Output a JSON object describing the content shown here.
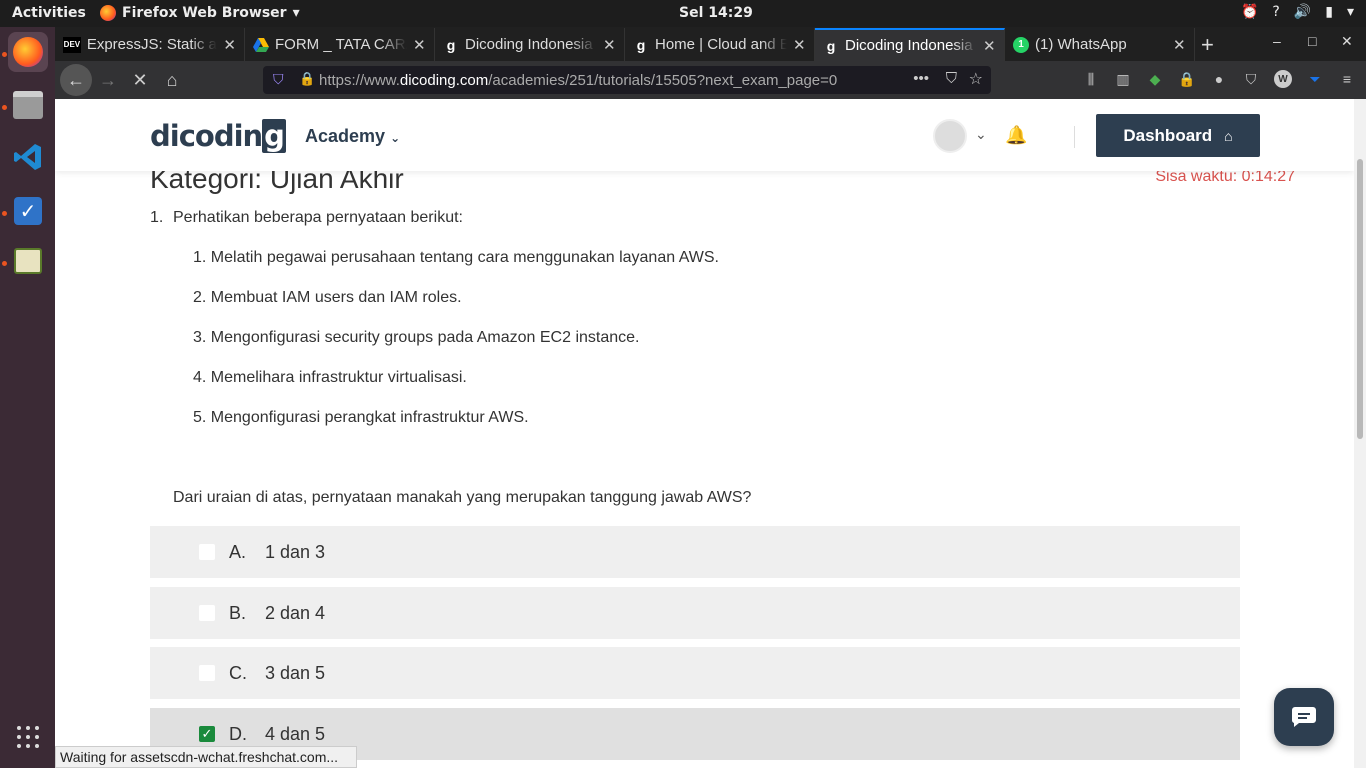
{
  "topbar": {
    "activities": "Activities",
    "app_name": "Firefox Web Browser",
    "clock": "Sel 14:29",
    "tray_help": "?"
  },
  "tabs": [
    {
      "favicon": "DEV",
      "title": "ExpressJS: Static and",
      "active": false
    },
    {
      "favicon": "drive-icon",
      "title": "FORM _ TATA CARA",
      "active": false
    },
    {
      "favicon": "dicoding-icon",
      "title": "Dicoding Indonesia",
      "active": false
    },
    {
      "favicon": "dicoding-icon",
      "title": "Home | Cloud and E",
      "active": false
    },
    {
      "favicon": "dicoding-icon",
      "title": "Dicoding Indonesia",
      "active": true
    },
    {
      "favicon": "whatsapp-icon",
      "title": "(1) WhatsApp",
      "active": false
    }
  ],
  "navbar": {
    "url_prefix": "https://www.",
    "url_domain": "dicoding.com",
    "url_path": "/academies/251/tutorials/15505?next_exam_page=0"
  },
  "header": {
    "logo": "dicodin",
    "logo_g": "g",
    "menu_academy": "Academy",
    "dashboard_label": "Dashboard"
  },
  "exam": {
    "heading": "Kategori: Ujian Akhir",
    "timer": "Sisa waktu: 0:14:27",
    "question_number": "1.",
    "intro": "Perhatikan beberapa pernyataan berikut:",
    "statements": [
      "1. Melatih pegawai perusahaan tentang cara menggunakan layanan AWS.",
      "2. Membuat IAM users dan IAM roles.",
      "3. Mengonfigurasi security groups pada Amazon EC2 instance.",
      "4. Memelihara infrastruktur virtualisasi.",
      "5. Mengonfigurasi perangkat infrastruktur AWS."
    ],
    "question": "Dari uraian di atas, pernyataan manakah yang merupakan tanggung jawab AWS?",
    "options": [
      {
        "letter": "A.",
        "text": "1 dan 3",
        "checked": false
      },
      {
        "letter": "B.",
        "text": "2 dan 4",
        "checked": false
      },
      {
        "letter": "C.",
        "text": "3 dan 5",
        "checked": false
      },
      {
        "letter": "D.",
        "text": "4 dan 5",
        "checked": true
      }
    ]
  },
  "status_text": "Waiting for assetscdn-wchat.freshchat.com..."
}
